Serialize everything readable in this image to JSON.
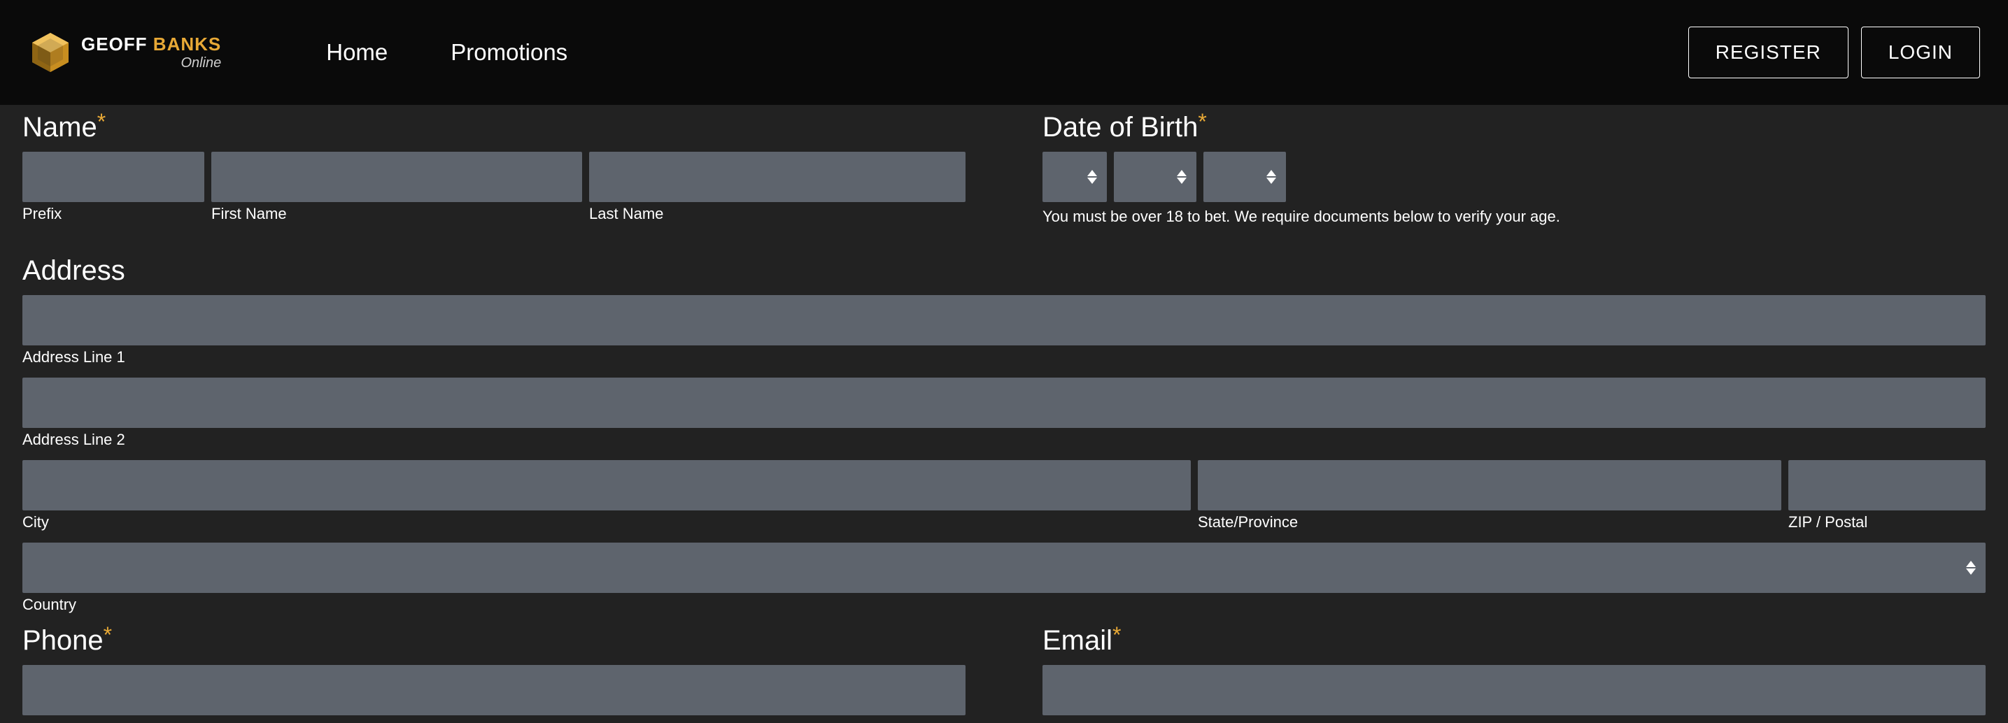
{
  "header": {
    "logo_main_1": "GEOFF",
    "logo_main_2": "BANKS",
    "logo_sub": "Online",
    "nav": {
      "home": "Home",
      "promotions": "Promotions"
    },
    "register": "REGISTER",
    "login": "LOGIN"
  },
  "form": {
    "name": {
      "title": "Name",
      "prefix_label": "Prefix",
      "first_label": "First Name",
      "last_label": "Last Name"
    },
    "dob": {
      "title": "Date of Birth",
      "helper": "You must be over 18 to bet. We require documents below to verify your age."
    },
    "address": {
      "title": "Address",
      "line1_label": "Address Line 1",
      "line2_label": "Address Line 2",
      "city_label": "City",
      "state_label": "State/Province",
      "zip_label": "ZIP / Postal",
      "country_label": "Country"
    },
    "phone": {
      "title": "Phone"
    },
    "email": {
      "title": "Email"
    }
  }
}
